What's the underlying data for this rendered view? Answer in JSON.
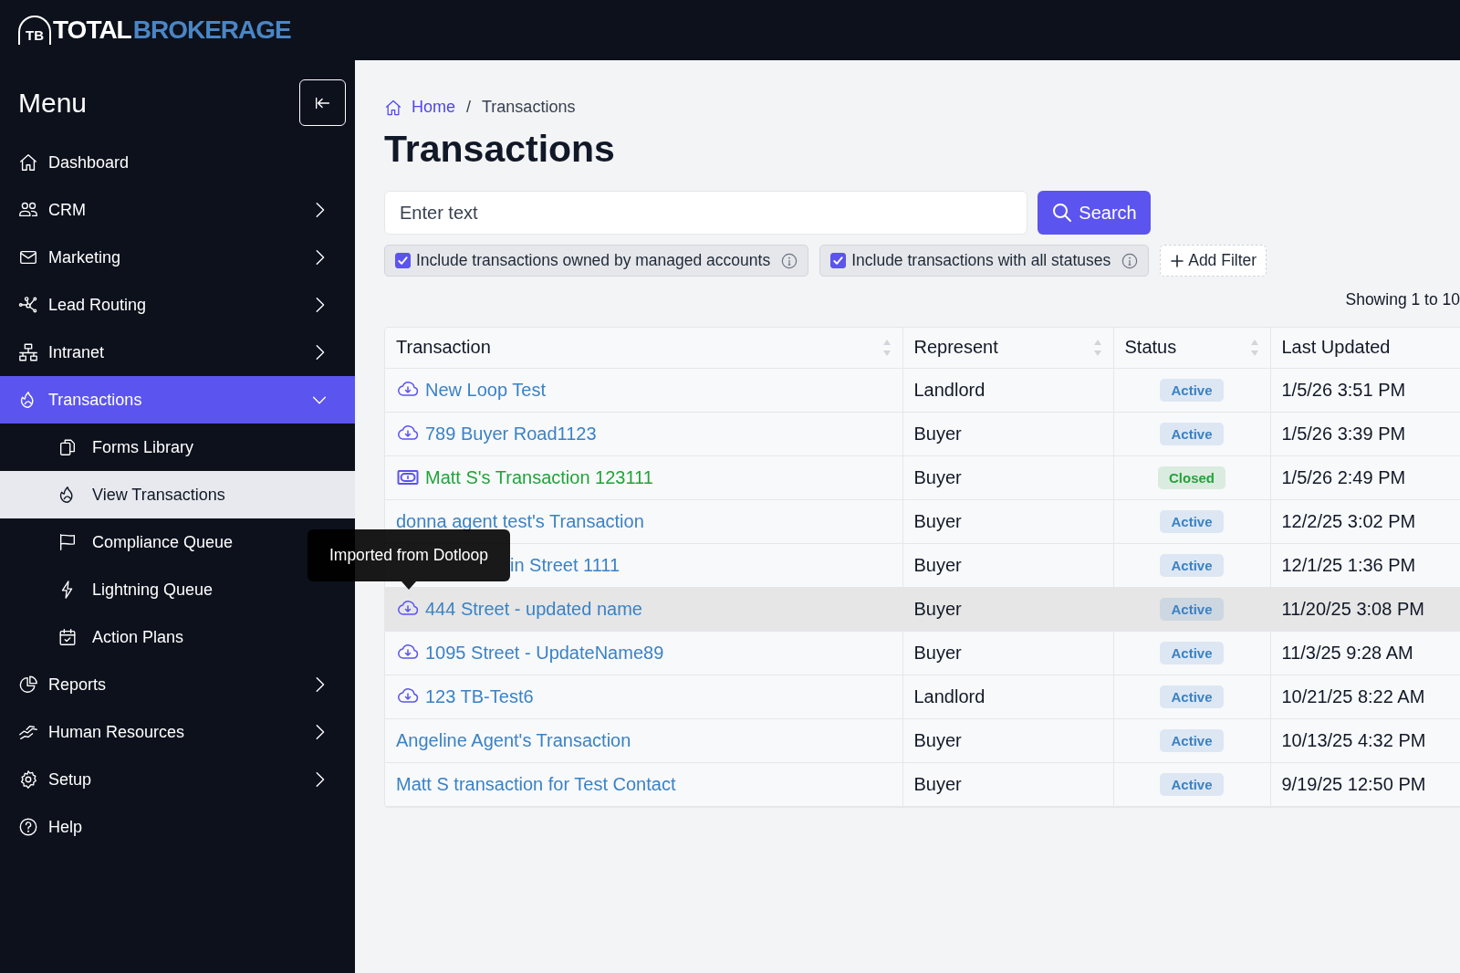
{
  "header": {
    "logo_mark": "TB",
    "logo_word_1": "TOTAL",
    "logo_word_2": "BROKERAGE"
  },
  "sidebar": {
    "title": "Menu",
    "items": [
      {
        "label": "Dashboard",
        "expandable": false,
        "selected": false
      },
      {
        "label": "CRM",
        "expandable": true,
        "expanded": false,
        "selected": false
      },
      {
        "label": "Marketing",
        "expandable": true,
        "expanded": false,
        "selected": false
      },
      {
        "label": "Lead Routing",
        "expandable": true,
        "expanded": false,
        "selected": false
      },
      {
        "label": "Intranet",
        "expandable": true,
        "expanded": false,
        "selected": false
      },
      {
        "label": "Transactions",
        "expandable": true,
        "expanded": true,
        "selected": true,
        "children": [
          {
            "label": "Forms Library",
            "selected": false
          },
          {
            "label": "View Transactions",
            "selected": true
          },
          {
            "label": "Compliance Queue",
            "selected": false
          },
          {
            "label": "Lightning Queue",
            "selected": false
          },
          {
            "label": "Action Plans",
            "selected": false
          }
        ]
      },
      {
        "label": "Reports",
        "expandable": true,
        "expanded": false,
        "selected": false
      },
      {
        "label": "Human Resources",
        "expandable": true,
        "expanded": false,
        "selected": false
      },
      {
        "label": "Setup",
        "expandable": true,
        "expanded": false,
        "selected": false
      },
      {
        "label": "Help",
        "expandable": false,
        "selected": false
      }
    ]
  },
  "breadcrumb": {
    "items": [
      "Home",
      "Transactions"
    ],
    "separator": "/"
  },
  "page_title": "Transactions",
  "search": {
    "placeholder": "Enter text",
    "button": "Search"
  },
  "filters": [
    {
      "label": "Include transactions owned by managed accounts",
      "checked": true
    },
    {
      "label": "Include transactions with all statuses",
      "checked": true
    }
  ],
  "add_filter": "Add Filter",
  "showing": "Showing 1 to 10",
  "table": {
    "columns": [
      {
        "label": "Transaction",
        "sortable": true
      },
      {
        "label": "Represent",
        "sortable": true
      },
      {
        "label": "Status",
        "sortable": true
      },
      {
        "label": "Last Updated"
      }
    ],
    "rows": [
      {
        "kind": "imported",
        "transaction": "New Loop Test",
        "color": "#3b82c4",
        "represent": "Landlord",
        "status": {
          "label": "Active",
          "color": "#3b82c4"
        },
        "updated": "1/5/26 3:51 PM",
        "hovered": false
      },
      {
        "kind": "imported",
        "transaction": "789 Buyer Road1123",
        "color": "#3b82c4",
        "represent": "Buyer",
        "status": {
          "label": "Active",
          "color": "#3b82c4"
        },
        "updated": "1/5/26 3:39 PM",
        "hovered": false
      },
      {
        "kind": "money",
        "transaction": "Matt S's Transaction 123111",
        "color": "#22a33a",
        "represent": "Buyer",
        "status": {
          "label": "Closed",
          "color": "#22a33a"
        },
        "updated": "1/5/26 2:49 PM",
        "hovered": false
      },
      {
        "kind": "plain",
        "transaction": "donna agent test's Transaction",
        "color": "#3b82c4",
        "represent": "Buyer",
        "status": {
          "label": "Active",
          "color": "#3b82c4"
        },
        "updated": "12/2/25 3:02 PM",
        "hovered": false
      },
      {
        "kind": "covered",
        "transaction": "in Street 1111",
        "color": "#3b82c4",
        "represent": "Buyer",
        "status": {
          "label": "Active",
          "color": "#3b82c4"
        },
        "updated": "12/1/25 1:36 PM",
        "hovered": false
      },
      {
        "kind": "imported",
        "transaction": "444 Street - updated name",
        "color": "#3b82c4",
        "represent": "Buyer",
        "status": {
          "label": "Active",
          "color": "#3b82c4"
        },
        "updated": "11/20/25 3:08 PM",
        "hovered": true
      },
      {
        "kind": "imported",
        "transaction": "1095 Street - UpdateName89",
        "color": "#3b82c4",
        "represent": "Buyer",
        "status": {
          "label": "Active",
          "color": "#3b82c4"
        },
        "updated": "11/3/25 9:28 AM",
        "hovered": false
      },
      {
        "kind": "imported",
        "transaction": "123 TB-Test6",
        "color": "#3b82c4",
        "represent": "Landlord",
        "status": {
          "label": "Active",
          "color": "#3b82c4"
        },
        "updated": "10/21/25 8:22 AM",
        "hovered": false
      },
      {
        "kind": "plain",
        "transaction": "Angeline Agent's Transaction",
        "color": "#3b82c4",
        "represent": "Buyer",
        "status": {
          "label": "Active",
          "color": "#3b82c4"
        },
        "updated": "10/13/25 4:32 PM",
        "hovered": false
      },
      {
        "kind": "plain",
        "transaction": "Matt S transaction for Test Contact",
        "color": "#3b82c4",
        "represent": "Buyer",
        "status": {
          "label": "Active",
          "color": "#3b82c4"
        },
        "updated": "9/19/25 12:50 PM",
        "hovered": false
      }
    ]
  },
  "tooltip": "Imported from Dotloop"
}
